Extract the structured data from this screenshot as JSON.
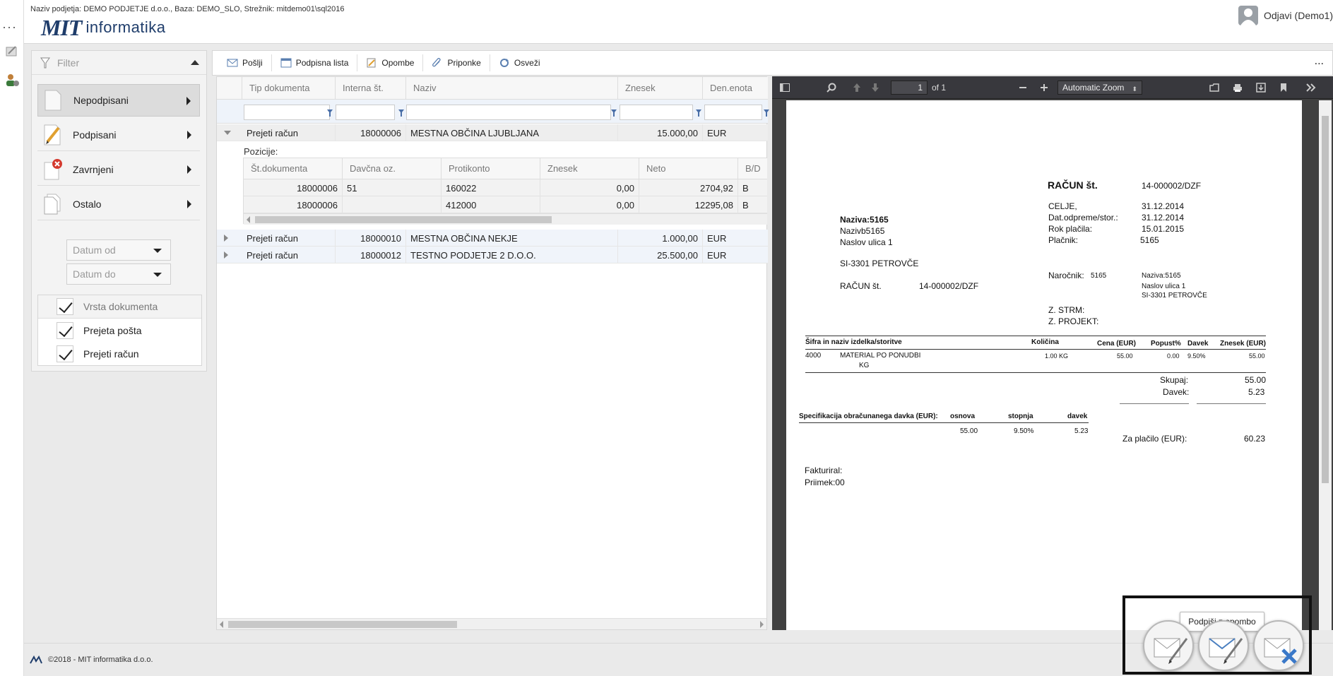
{
  "header": {
    "info": "Naziv podjetja: DEMO PODJETJE d.o.o., Baza: DEMO_SLO, Strežnik: mitdemo01\\sql2016",
    "logo_mark": "MIT",
    "logo_text": "informatika",
    "logout_label": "Odjavi (Demo1)"
  },
  "sidebar": {
    "filter_placeholder": "Filter",
    "items": [
      {
        "label": "Nepodpisani",
        "icon": "blank-doc-icon"
      },
      {
        "label": "Podpisani",
        "icon": "pencil-icon"
      },
      {
        "label": "Zavrnjeni",
        "icon": "rejected-doc-icon"
      },
      {
        "label": "Ostalo",
        "icon": "documents-icon"
      }
    ],
    "date_from_placeholder": "Datum od",
    "date_to_placeholder": "Datum do",
    "doc_types_header": "Vrsta dokumenta",
    "doc_types": [
      {
        "label": "Prejeta pošta",
        "checked": true
      },
      {
        "label": "Prejeti račun",
        "checked": true
      }
    ]
  },
  "toolbar": {
    "buttons": [
      {
        "label": "Pošlji",
        "icon": "envelope-icon"
      },
      {
        "label": "Podpisna lista",
        "icon": "calendar-icon"
      },
      {
        "label": "Opombe",
        "icon": "note-icon"
      },
      {
        "label": "Priponke",
        "icon": "paperclip-icon"
      },
      {
        "label": "Osveži",
        "icon": "refresh-icon"
      }
    ],
    "more": "..."
  },
  "grid": {
    "columns": [
      "Tip dokumenta",
      "Interna št.",
      "Naziv",
      "Znesek",
      "Den.enota"
    ],
    "rows": [
      {
        "tip": "Prejeti račun",
        "interna": "18000006",
        "naziv": "MESTNA OBČINA LJUBLJANA",
        "znesek": "15.000,00",
        "valuta": "EUR",
        "expanded": true
      },
      {
        "tip": "Prejeti račun",
        "interna": "18000010",
        "naziv": "MESTNA OBČINA NEKJE",
        "znesek": "1.000,00",
        "valuta": "EUR",
        "expanded": false
      },
      {
        "tip": "Prejeti račun",
        "interna": "18000012",
        "naziv": "TESTNO PODJETJE 2 D.O.O.",
        "znesek": "25.500,00",
        "valuta": "EUR",
        "expanded": false
      }
    ],
    "detail": {
      "label": "Pozicije:",
      "columns": [
        "Št.dokumenta",
        "Davčna oz.",
        "Protikonto",
        "Znesek",
        "Neto",
        "B/D"
      ],
      "rows": [
        {
          "st": "18000006",
          "davcna": "51",
          "protikonto": "160022",
          "znesek": "0,00",
          "neto": "2704,92",
          "bd": "B"
        },
        {
          "st": "18000006",
          "davcna": "",
          "protikonto": "412000",
          "znesek": "0,00",
          "neto": "12295,08",
          "bd": "B"
        }
      ]
    }
  },
  "pdf": {
    "page_number": "1",
    "page_of": "of 1",
    "zoom": "Automatic Zoom",
    "invoice": {
      "title": "RAČUN št.",
      "number": "14-000002/DZF",
      "city_label": "CELJE,",
      "city_date": "31.12.2014",
      "dispatch_label": "Dat.odpreme/stor.:",
      "dispatch_date": "31.12.2014",
      "due_label": "Rok plačila:",
      "due_date": "15.01.2015",
      "payer_label": "Plačnik:",
      "payer_value": "5165",
      "buyer_name_a": "Naziva:5165",
      "buyer_name_b": "Nazivb5165",
      "buyer_street": "Naslov ulica 1",
      "buyer_city": "SI-3301 PETROVČE",
      "ref_label": "RAČUN št.",
      "ref_number": "14-000002/DZF",
      "orderer_label": "Naročnik:",
      "orderer_code": "5165",
      "orderer_name": "Naziva:5165",
      "orderer_street": "Naslov ulica 1",
      "orderer_city": "SI-3301 PETROVČE",
      "strm": "Z. STRM:",
      "projekt": "Z. PROJEKT:",
      "table_headers": [
        "Šifra in naziv izdelka/storitve",
        "Količina",
        "Cena (EUR)",
        "Popust%",
        "Davek",
        "Znesek (EUR)"
      ],
      "item_code": "4000",
      "item_name": "MATERIAL PO PONUDBI",
      "item_unit": "KG",
      "item_qty": "1.00 KG",
      "item_price": "55.00",
      "item_discount": "0.00",
      "item_tax": "9.50%",
      "item_total": "55.00",
      "skupaj_label": "Skupaj:",
      "skupaj_value": "55.00",
      "davek_label": "Davek:",
      "davek_value": "5.23",
      "spec_label": "Specifikacija obračunanega davka (EUR):",
      "spec_headers": [
        "osnova",
        "stopnja",
        "davek"
      ],
      "spec_values": [
        "55.00",
        "9.50%",
        "5.23"
      ],
      "za_placilo_label": "Za plačilo (EUR):",
      "za_placilo_value": "60.23",
      "fakturiral": "Fakturiral:",
      "priimek": "Priimek:00"
    }
  },
  "footer": {
    "text": "©2018 -  MIT informatika d.o.o."
  },
  "sign": {
    "tooltip": "Podpiši z opombo"
  }
}
